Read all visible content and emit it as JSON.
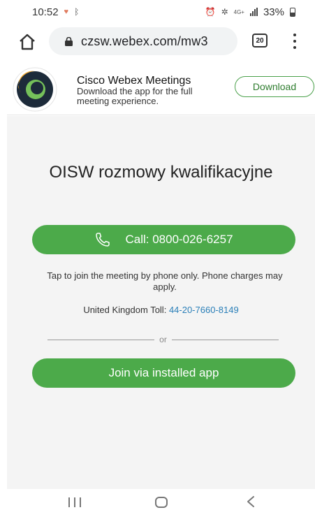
{
  "status_bar": {
    "time": "10:52",
    "network": "4G+",
    "battery": "33%"
  },
  "browser": {
    "url": "czsw.webex.com/mw3",
    "tab_count": "20"
  },
  "app_banner": {
    "title": "Cisco Webex Meetings",
    "subtitle": "Download the app for the full meeting experience.",
    "download_label": "Download"
  },
  "meeting": {
    "title": "OISW rozmowy kwalifikacyjne",
    "call_label": "Call: 0800-026-6257",
    "phone_note": "Tap to join the meeting by phone only. Phone charges may apply.",
    "toll_label": "United Kingdom Toll:",
    "toll_number": "44-20-7660-8149",
    "divider_text": "or",
    "join_app_label": "Join via installed app"
  },
  "colors": {
    "accent_green": "#4caa4a",
    "link_blue": "#2a7fb8",
    "background": "#f4f4f4"
  },
  "icons": {
    "status": [
      "heart-icon",
      "bluetooth-icon",
      "alarm-icon",
      "signal-icon",
      "battery-icon"
    ],
    "toolbar": [
      "home-icon",
      "lock-icon",
      "tabs-icon",
      "more-vert-icon"
    ],
    "call": "phone-icon",
    "nav": [
      "recents-icon",
      "home-nav-icon",
      "back-icon"
    ]
  }
}
